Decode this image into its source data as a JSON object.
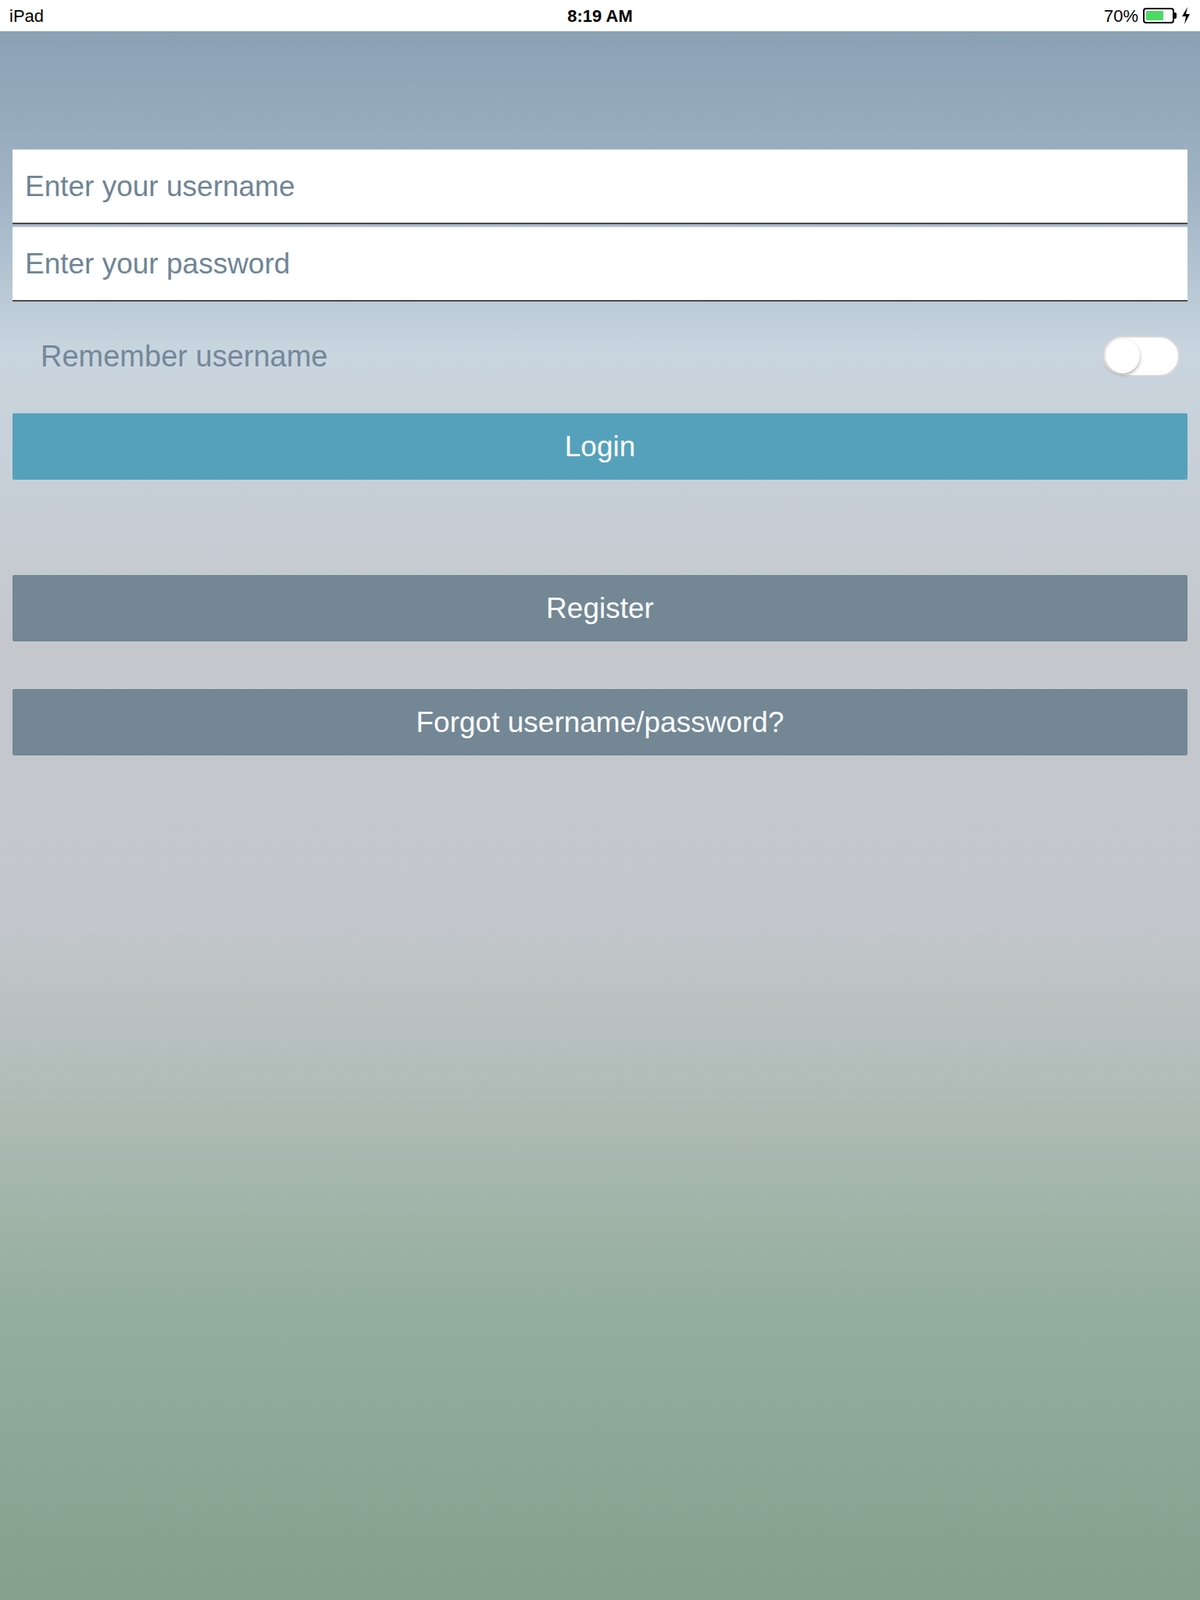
{
  "status_bar": {
    "device": "iPad",
    "time": "8:19 AM",
    "battery": "70%",
    "battery_level": 0.7,
    "charging": true
  },
  "fields": [
    {
      "placeholder": "Enter your username",
      "kind": "text"
    },
    {
      "placeholder": "Enter your password",
      "kind": "password"
    }
  ],
  "remember": {
    "label": "Remember username",
    "on": false
  },
  "buttons": [
    {
      "label": "Login",
      "kind": "primary"
    },
    {
      "label": "Register",
      "kind": "secondary"
    },
    {
      "label": "Forgot username/password?",
      "kind": "secondary"
    }
  ]
}
